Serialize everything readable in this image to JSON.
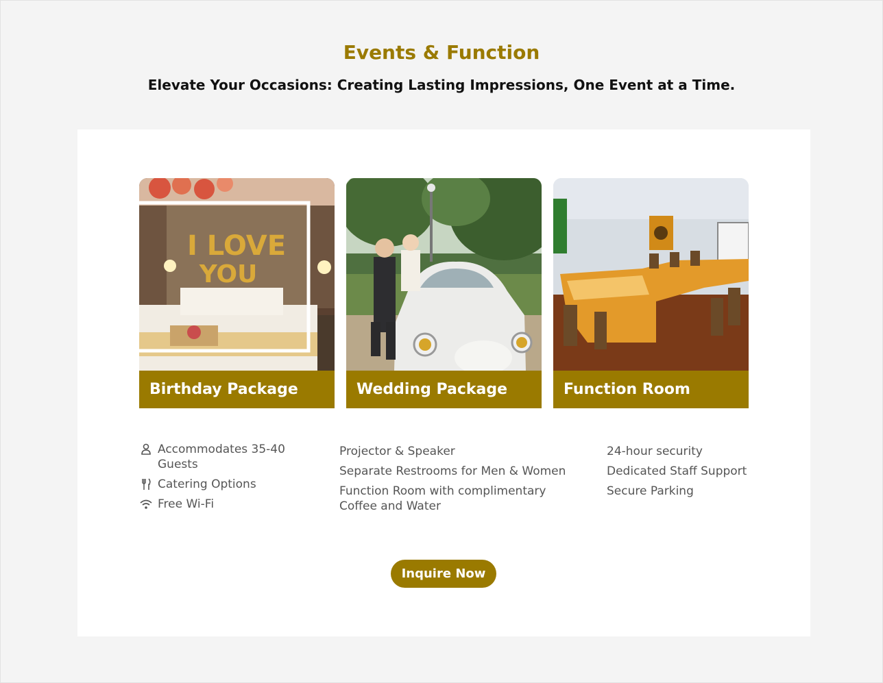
{
  "header": {
    "title": "Events & Function",
    "subtitle": "Elevate Your Occasions: Creating Lasting Impressions, One Event at a Time."
  },
  "cards": [
    {
      "label": "Birthday Package"
    },
    {
      "label": "Wedding Package"
    },
    {
      "label": "Function Room"
    }
  ],
  "birthday_features": [
    {
      "icon": "person-icon",
      "text": "Accommodates 35-40 Guests"
    },
    {
      "icon": "utensils-icon",
      "text": "Catering Options"
    },
    {
      "icon": "wifi-icon",
      "text": "Free Wi-Fi"
    }
  ],
  "function_features": [
    "Projector & Speaker",
    "Separate Restrooms for Men & Women",
    "Function Room with complimentary Coffee and Water"
  ],
  "service_features": [
    "24-hour security",
    "Dedicated Staff Support",
    "Secure Parking"
  ],
  "cta": {
    "label": "Inquire Now"
  },
  "colors": {
    "accent": "#9a7a00",
    "background": "#f4f4f4",
    "panel": "#ffffff"
  }
}
